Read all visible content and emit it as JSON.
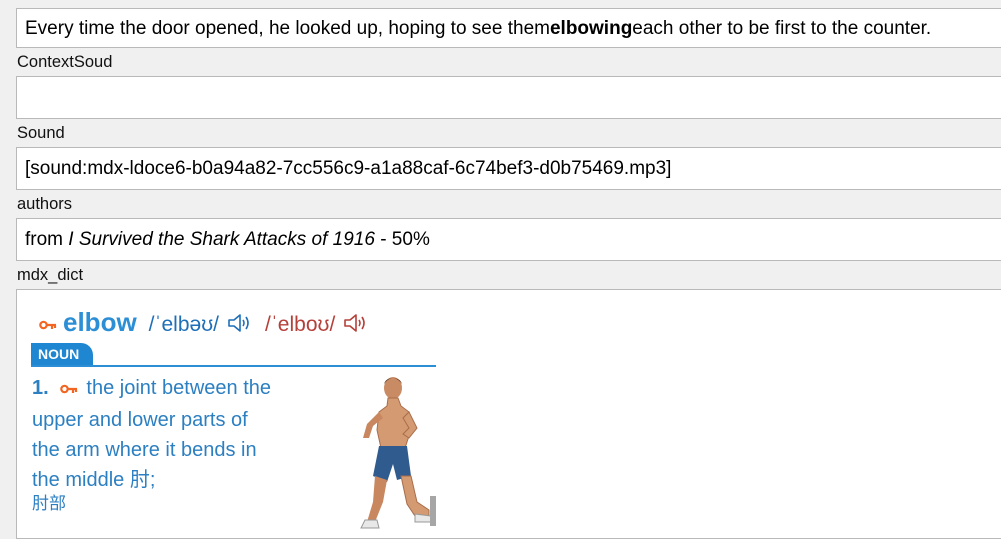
{
  "sentence": {
    "before": "Every time the door opened, he looked up, hoping to see them ",
    "bold": "elbowing",
    "after": " each other to be first to the counter."
  },
  "fields": {
    "context_sound_label": "ContextSoud",
    "context_sound_value": "",
    "sound_label": "Sound",
    "sound_value": "[sound:mdx-ldoce6-b0a94a82-7cc556c9-a1a88caf-6c74bef3-d0b75469.mp3]",
    "authors_label": "authors",
    "authors_prefix": "from ",
    "authors_title": "I Survived the Shark Attacks of 1916",
    "authors_suffix": " - 50%",
    "mdx_dict_label": "mdx_dict"
  },
  "dict": {
    "key_symbol": "⸞",
    "headword": "elbow",
    "pron_br": "/ˈelbəʊ/",
    "pron_am": "/ˈelboʊ/",
    "pos": "NOUN",
    "sense_num": "1.",
    "sense_text": "the joint between the upper and lower parts of the arm where it bends in the middle 肘;",
    "sense_cn2": "肘部"
  },
  "icons": {
    "key": "key-icon",
    "speaker": "speaker-icon"
  },
  "colors": {
    "headword": "#2c8fd6",
    "pron_br": "#1f6fb8",
    "pron_am": "#b5403a",
    "key": "#f26522",
    "pos_badge": "#1f86d1"
  }
}
